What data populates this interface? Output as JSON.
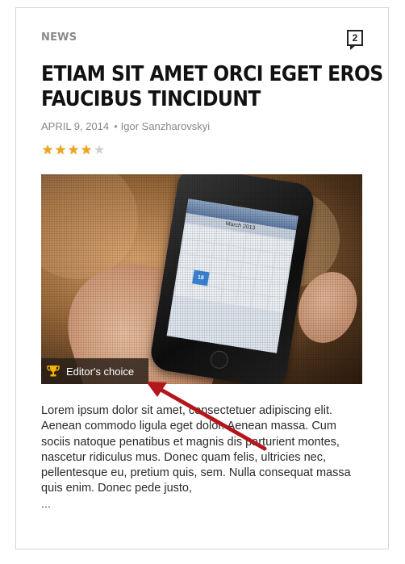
{
  "article": {
    "category": "NEWS",
    "comment_count": "2",
    "title_line1": "ETIAM SIT AMET ORCI EGET EROS",
    "title_line2": "FAUCIBUS TINCIDUNT",
    "date": "APRIL 9, 2014",
    "meta_separator": "•",
    "author": "Igor Sanzharovskyi",
    "rating": {
      "value": 4,
      "max": 5,
      "star_on_color": "#f2a31b",
      "star_off_color": "#cfcfcf"
    },
    "image_badge": {
      "icon": "trophy-icon",
      "label": "Editor's choice"
    },
    "calendar_month": "March 2013",
    "selected_day": "18",
    "excerpt": "Lorem ipsum dolor sit amet, consectetuer adipiscing elit. Aenean commodo ligula eget dolor. Aenean massa. Cum sociis natoque penatibus et magnis dis parturient montes, nascetur ridiculus mus. Donec quam felis, ultricies nec, pellentesque eu, pretium quis, sem. Nulla consequat massa quis enim. Donec pede justo,",
    "more": "..."
  },
  "annotation": {
    "arrow_color": "#b3161b"
  }
}
